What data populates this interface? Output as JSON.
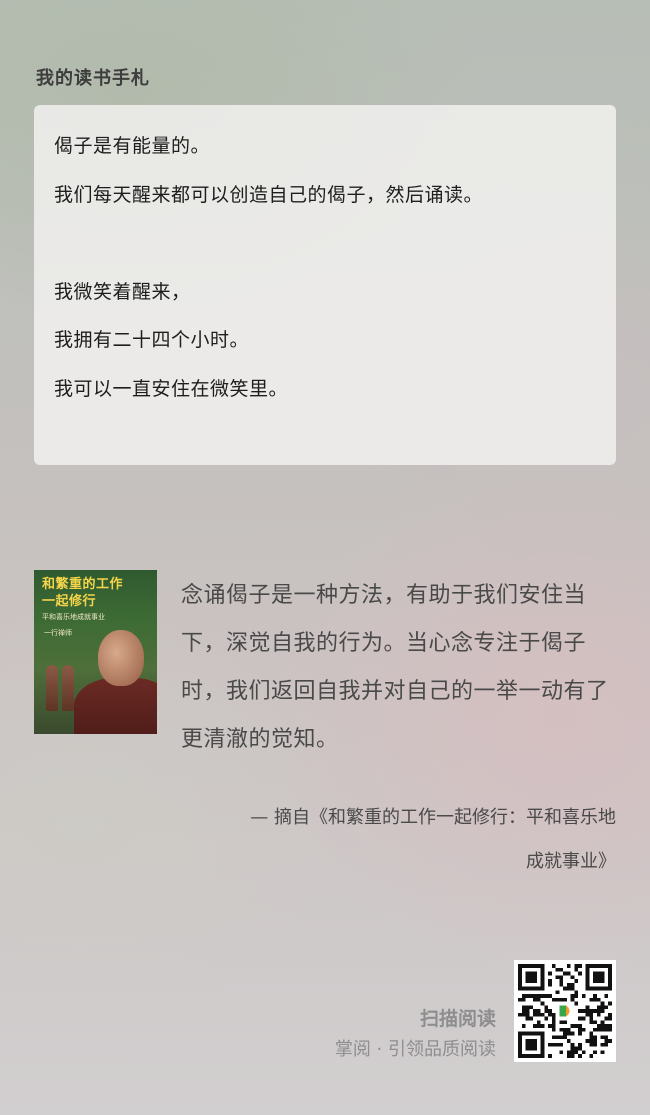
{
  "header": {
    "title": "我的读书手札"
  },
  "quote_card": {
    "lines": [
      "偈子是有能量的。",
      "我们每天醒来都可以创造自己的偈子，然后诵读。",
      "",
      "我微笑着醒来，",
      "我拥有二十四个小时。",
      "我可以一直安住在微笑里。"
    ]
  },
  "book": {
    "cover_title_line1": "和繁重的工作",
    "cover_title_line2": "一起修行",
    "cover_subtitle": "平和喜乐地成就事业",
    "cover_author": "一行禅师"
  },
  "excerpt": {
    "text": "念诵偈子是一种方法，有助于我们安住当下，深觉自我的行为。当心念专注于偈子时，我们返回自我并对自己的一举一动有了更清澈的觉知。"
  },
  "source": {
    "line1": "—  摘自《和繁重的工作一起修行：平和喜乐地",
    "line2": "成就事业》"
  },
  "footer": {
    "scan_label": "扫描阅读",
    "tagline": "掌阅 · 引领品质阅读"
  },
  "colors": {
    "qr_logo_green": "#3aa64a",
    "qr_logo_orange": "#f29a2e"
  }
}
